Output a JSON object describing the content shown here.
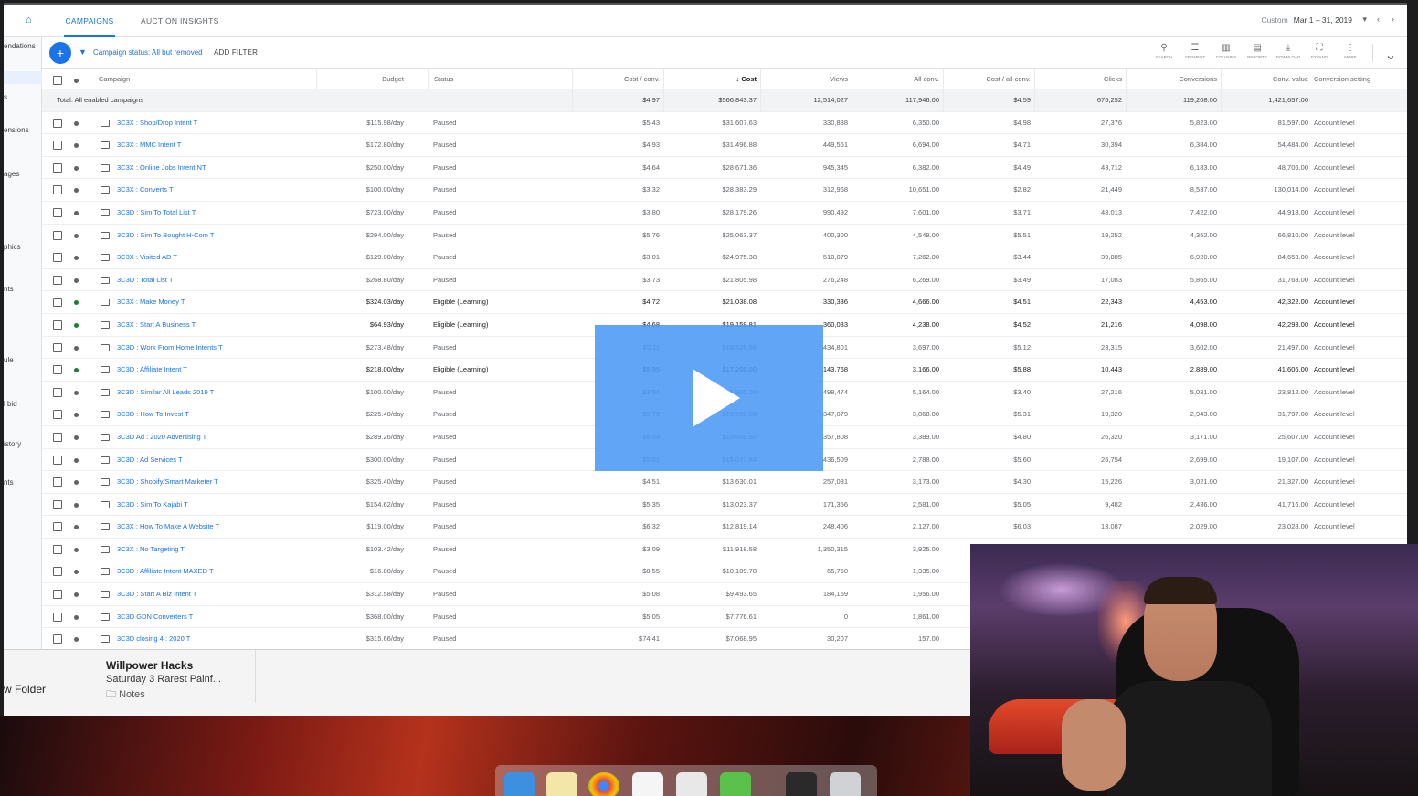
{
  "tabs": {
    "campaigns": "CAMPAIGNS",
    "auction_insights": "AUCTION INSIGHTS"
  },
  "date_range": {
    "label": "Custom",
    "value": "Mar 1 – 31, 2019"
  },
  "left_nav": [
    "endations",
    "s",
    "ensions",
    "ages",
    "phics",
    "nts",
    "ule",
    "l bid",
    "istory",
    "nts"
  ],
  "filter": {
    "text": "Campaign status: All but removed",
    "add_filter": "ADD FILTER"
  },
  "toolbar": [
    {
      "label": "SEARCH",
      "icon": "search-icon"
    },
    {
      "label": "SEGMENT",
      "icon": "segment-icon"
    },
    {
      "label": "COLUMNS",
      "icon": "columns-icon"
    },
    {
      "label": "REPORTS",
      "icon": "reports-icon"
    },
    {
      "label": "DOWNLOAD",
      "icon": "download-icon"
    },
    {
      "label": "EXPAND",
      "icon": "expand-icon"
    },
    {
      "label": "MORE",
      "icon": "more-icon"
    }
  ],
  "columns": [
    "Campaign",
    "Budget",
    "Status",
    "Cost / conv.",
    "Cost",
    "Views",
    "All conv.",
    "Cost / all conv.",
    "Clicks",
    "Conversions",
    "Conv. value",
    "Conversion setting"
  ],
  "total": {
    "label": "Total: All enabled campaigns",
    "cost_conv": "$4.97",
    "cost": "$566,843.37",
    "views": "12,514,027",
    "all_conv": "117,946.00",
    "cost_all_conv": "$4.59",
    "clicks": "675,252",
    "conversions": "119,208.00",
    "conv_value": "1,421,657.00"
  },
  "rows": [
    {
      "name": "3C3X : Shop/Drop Intent T",
      "budget": "$115.98/day",
      "status": "Paused",
      "cost_conv": "$5.43",
      "cost": "$31,607.63",
      "views": "330,838",
      "all_conv": "6,350.00",
      "cost_all_conv": "$4.98",
      "clicks": "27,376",
      "conversions": "5,823.00",
      "conv_value": "81,597.00",
      "setting": "Account level",
      "active": false
    },
    {
      "name": "3C3X : MMC Intent T",
      "budget": "$172.80/day",
      "status": "Paused",
      "cost_conv": "$4.93",
      "cost": "$31,496.88",
      "views": "449,561",
      "all_conv": "6,694.00",
      "cost_all_conv": "$4.71",
      "clicks": "30,394",
      "conversions": "6,384.00",
      "conv_value": "54,484.00",
      "setting": "Account level",
      "active": false
    },
    {
      "name": "3C3X : Online Jobs Intent NT",
      "budget": "$250.00/day",
      "status": "Paused",
      "cost_conv": "$4.64",
      "cost": "$28,671.36",
      "views": "945,345",
      "all_conv": "6,382.00",
      "cost_all_conv": "$4.49",
      "clicks": "43,712",
      "conversions": "6,183.00",
      "conv_value": "48,706.00",
      "setting": "Account level",
      "active": false
    },
    {
      "name": "3C3X : Converts T",
      "budget": "$100.00/day",
      "status": "Paused",
      "cost_conv": "$3.32",
      "cost": "$28,383.29",
      "views": "312,968",
      "all_conv": "10,651.00",
      "cost_all_conv": "$2.82",
      "clicks": "21,449",
      "conversions": "8,537.00",
      "conv_value": "130,014.00",
      "setting": "Account level",
      "active": false
    },
    {
      "name": "3C3D : Sim To Total List T",
      "budget": "$723.00/day",
      "status": "Paused",
      "cost_conv": "$3.80",
      "cost": "$28,179.26",
      "views": "990,492",
      "all_conv": "7,601.00",
      "cost_all_conv": "$3.71",
      "clicks": "48,013",
      "conversions": "7,422.00",
      "conv_value": "44,918.00",
      "setting": "Account level",
      "active": false
    },
    {
      "name": "3C3D : Sim To Bought H-Com T",
      "budget": "$294.00/day",
      "status": "Paused",
      "cost_conv": "$5.76",
      "cost": "$25,063.37",
      "views": "400,300",
      "all_conv": "4,549.00",
      "cost_all_conv": "$5.51",
      "clicks": "19,252",
      "conversions": "4,352.00",
      "conv_value": "66,810.00",
      "setting": "Account level",
      "active": false
    },
    {
      "name": "3C3X : Visited AD T",
      "budget": "$129.00/day",
      "status": "Paused",
      "cost_conv": "$3.01",
      "cost": "$24,975.38",
      "views": "510,079",
      "all_conv": "7,262.00",
      "cost_all_conv": "$3.44",
      "clicks": "39,885",
      "conversions": "6,920.00",
      "conv_value": "84,653.00",
      "setting": "Account level",
      "active": false
    },
    {
      "name": "3C3D : Total List T",
      "budget": "$268.80/day",
      "status": "Paused",
      "cost_conv": "$3.73",
      "cost": "$21,805.98",
      "views": "276,248",
      "all_conv": "6,269.00",
      "cost_all_conv": "$3.49",
      "clicks": "17,083",
      "conversions": "5,865.00",
      "conv_value": "31,768.00",
      "setting": "Account level",
      "active": false
    },
    {
      "name": "3C3X : Make Money T",
      "budget": "$324.03/day",
      "status": "Eligible (Learning)",
      "cost_conv": "$4.72",
      "cost": "$21,038.08",
      "views": "330,336",
      "all_conv": "4,666.00",
      "cost_all_conv": "$4.51",
      "clicks": "22,343",
      "conversions": "4,453.00",
      "conv_value": "42,322.00",
      "setting": "Account level",
      "active": true
    },
    {
      "name": "3C3X : Start A Business T",
      "budget": "$64.93/day",
      "status": "Eligible (Learning)",
      "cost_conv": "$4.68",
      "cost": "$19,159.81",
      "views": "360,033",
      "all_conv": "4,238.00",
      "cost_all_conv": "$4.52",
      "clicks": "21,216",
      "conversions": "4,098.00",
      "conv_value": "42,293.00",
      "setting": "Account level",
      "active": true
    },
    {
      "name": "3C3D : Work From Home Intents T",
      "budget": "$273.48/day",
      "status": "Paused",
      "cost_conv": "$5.11",
      "cost": "$18,526.56",
      "views": "434,801",
      "all_conv": "3,697.00",
      "cost_all_conv": "$5.12",
      "clicks": "23,315",
      "conversions": "3,602.00",
      "conv_value": "21,497.00",
      "setting": "Account level",
      "active": false
    },
    {
      "name": "3C3D : Affiliate Intent T",
      "budget": "$218.00/day",
      "status": "Eligible (Learning)",
      "cost_conv": "$5.95",
      "cost": "$17,208.00",
      "views": "143,768",
      "all_conv": "3,166.00",
      "cost_all_conv": "$5.88",
      "clicks": "10,443",
      "conversions": "2,889.00",
      "conv_value": "41,606.00",
      "setting": "Account level",
      "active": true
    },
    {
      "name": "3C3D : Similar All Leads 2019 T",
      "budget": "$100.00/day",
      "status": "Paused",
      "cost_conv": "$3.54",
      "cost": "$16,900.00",
      "views": "498,474",
      "all_conv": "5,164.00",
      "cost_all_conv": "$3.40",
      "clicks": "27,216",
      "conversions": "5,031.00",
      "conv_value": "23,812.00",
      "setting": "Account level",
      "active": false
    },
    {
      "name": "3C3D : How To Invest T",
      "budget": "$225.40/day",
      "status": "Paused",
      "cost_conv": "$5.79",
      "cost": "$16,500.00",
      "views": "347,079",
      "all_conv": "3,068.00",
      "cost_all_conv": "$5.31",
      "clicks": "19,320",
      "conversions": "2,943.00",
      "conv_value": "31,797.00",
      "setting": "Account level",
      "active": false
    },
    {
      "name": "3C3D Ad : 2020 Advertising T",
      "budget": "$289.26/day",
      "status": "Paused",
      "cost_conv": "$5.03",
      "cost": "$15,600.52",
      "views": "357,808",
      "all_conv": "3,389.00",
      "cost_all_conv": "$4.80",
      "clicks": "26,320",
      "conversions": "3,171.00",
      "conv_value": "25,607.00",
      "setting": "Account level",
      "active": false
    },
    {
      "name": "3C3D : Ad Services T",
      "budget": "$300.00/day",
      "status": "Paused",
      "cost_conv": "$5.81",
      "cost": "$15,073.84",
      "views": "436,509",
      "all_conv": "2,788.00",
      "cost_all_conv": "$5.60",
      "clicks": "26,754",
      "conversions": "2,699.00",
      "conv_value": "19,107.00",
      "setting": "Account level",
      "active": false
    },
    {
      "name": "3C3D : Shopify/Smart Marketer T",
      "budget": "$325.40/day",
      "status": "Paused",
      "cost_conv": "$4.51",
      "cost": "$13,630.01",
      "views": "257,081",
      "all_conv": "3,173.00",
      "cost_all_conv": "$4.30",
      "clicks": "15,226",
      "conversions": "3,021.00",
      "conv_value": "21,327.00",
      "setting": "Account level",
      "active": false
    },
    {
      "name": "3C3D : Sim To Kajabi T",
      "budget": "$154.62/day",
      "status": "Paused",
      "cost_conv": "$5.35",
      "cost": "$13,023.37",
      "views": "171,356",
      "all_conv": "2,581.00",
      "cost_all_conv": "$5.05",
      "clicks": "9,482",
      "conversions": "2,436.00",
      "conv_value": "41,716.00",
      "setting": "Account level",
      "active": false
    },
    {
      "name": "3C3X : How To Make A Website T",
      "budget": "$119.00/day",
      "status": "Paused",
      "cost_conv": "$6.32",
      "cost": "$12,819.14",
      "views": "248,406",
      "all_conv": "2,127.00",
      "cost_all_conv": "$6.03",
      "clicks": "13,087",
      "conversions": "2,029.00",
      "conv_value": "23,028.00",
      "setting": "Account level",
      "active": false
    },
    {
      "name": "3C3X : No Targeting T",
      "budget": "$103.42/day",
      "status": "Paused",
      "cost_conv": "$3.09",
      "cost": "$11,918.58",
      "views": "1,350,315",
      "all_conv": "3,925.00",
      "cost_all_conv": "",
      "clicks": "",
      "conversions": "",
      "conv_value": "",
      "setting": "",
      "active": false
    },
    {
      "name": "3C3D : Affiliate Intent MAXED T",
      "budget": "$16.80/day",
      "status": "Paused",
      "cost_conv": "$8.55",
      "cost": "$10,109.78",
      "views": "65,750",
      "all_conv": "1,335.00",
      "cost_all_conv": "",
      "clicks": "",
      "conversions": "",
      "conv_value": "",
      "setting": "",
      "active": false
    },
    {
      "name": "3C3D : Start A Biz Intent T",
      "budget": "$312.58/day",
      "status": "Paused",
      "cost_conv": "$5.08",
      "cost": "$9,493.65",
      "views": "184,159",
      "all_conv": "1,956.00",
      "cost_all_conv": "",
      "clicks": "",
      "conversions": "",
      "conv_value": "",
      "setting": "",
      "active": false
    },
    {
      "name": "3C3D GDN Converters T",
      "budget": "$368.00/day",
      "status": "Paused",
      "cost_conv": "$5.05",
      "cost": "$7,776.61",
      "views": "0",
      "all_conv": "1,861.00",
      "cost_all_conv": "",
      "clicks": "",
      "conversions": "",
      "conv_value": "",
      "setting": "",
      "active": false
    },
    {
      "name": "3C3D closing 4 : 2020 T",
      "budget": "$315.66/day",
      "status": "Paused",
      "cost_conv": "$74.41",
      "cost": "$7,068.95",
      "views": "30,207",
      "all_conv": "157.00",
      "cost_all_conv": "",
      "clicks": "",
      "conversions": "",
      "conv_value": "",
      "setting": "",
      "active": false
    }
  ],
  "notes": {
    "folder": "w Folder",
    "title": "Willpower Hacks",
    "subtitle": "Saturday  3 Rarest Painf...",
    "location": "Notes"
  },
  "colors": {
    "accent": "#1a73e8",
    "eligible": "#188038",
    "play_overlay": "#4a99f5"
  }
}
